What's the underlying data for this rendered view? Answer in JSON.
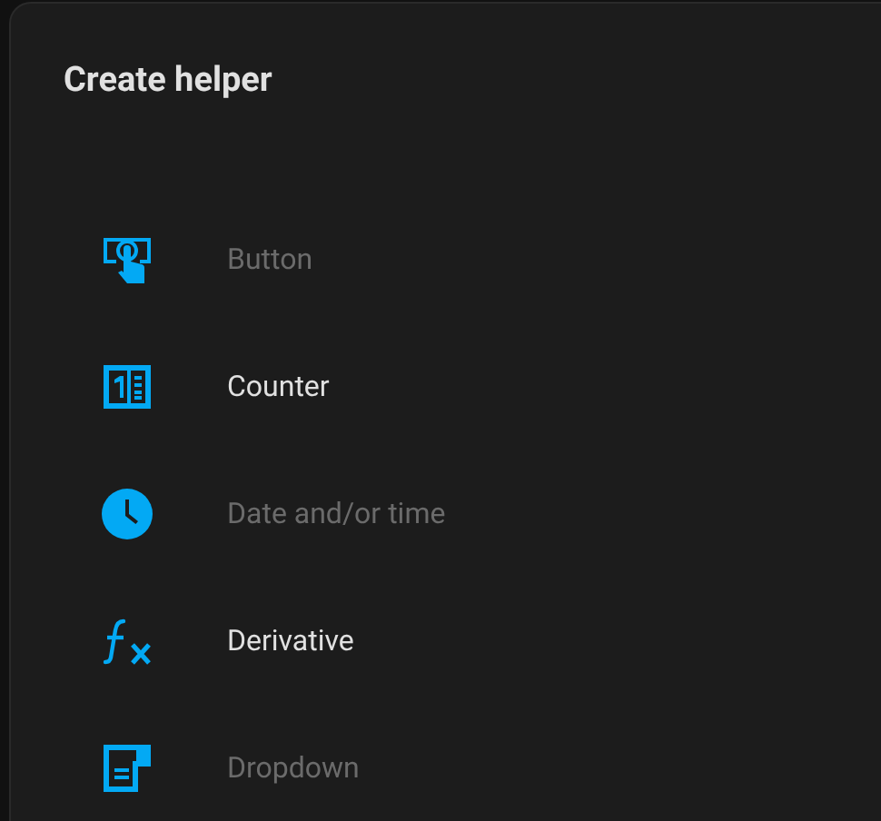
{
  "dialog": {
    "title": "Create helper"
  },
  "items": [
    {
      "label": "Button",
      "kind": "button",
      "disabled": true
    },
    {
      "label": "Counter",
      "kind": "counter",
      "disabled": false
    },
    {
      "label": "Date and/or time",
      "kind": "clock",
      "disabled": true
    },
    {
      "label": "Derivative",
      "kind": "function",
      "disabled": false
    },
    {
      "label": "Dropdown",
      "kind": "form",
      "disabled": true
    }
  ]
}
